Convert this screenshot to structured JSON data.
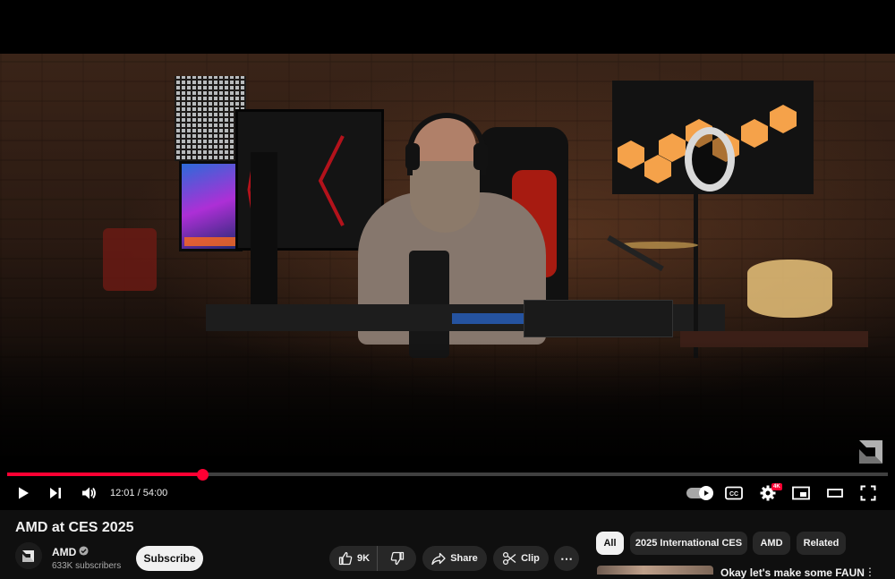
{
  "player": {
    "current_time": "12:01",
    "separator": " / ",
    "duration": "54:00",
    "progress_fraction": 0.2225,
    "quality_badge": "4K",
    "accent_color": "#ff0033",
    "icons": [
      "play-icon",
      "next-icon",
      "volume-icon",
      "autoplay-toggle",
      "cc-icon",
      "settings-icon",
      "miniplayer-icon",
      "theater-icon",
      "fullscreen-icon",
      "amd-watermark-icon"
    ]
  },
  "video": {
    "title": "AMD at CES 2025"
  },
  "channel": {
    "name": "AMD",
    "subscribers": "633K subscribers",
    "subscribe_label": "Subscribe"
  },
  "actions": {
    "like_count": "9K",
    "share_label": "Share",
    "clip_label": "Clip",
    "more_label": "⋯"
  },
  "chips": [
    {
      "label": "All",
      "active": true
    },
    {
      "label": "2025 International CES",
      "active": false
    },
    {
      "label": "AMD",
      "active": false
    },
    {
      "label": "Related",
      "active": false
    }
  ],
  "recommendation": {
    "title": "Okay let's make some FAUN",
    "menu_label": "⋮"
  }
}
